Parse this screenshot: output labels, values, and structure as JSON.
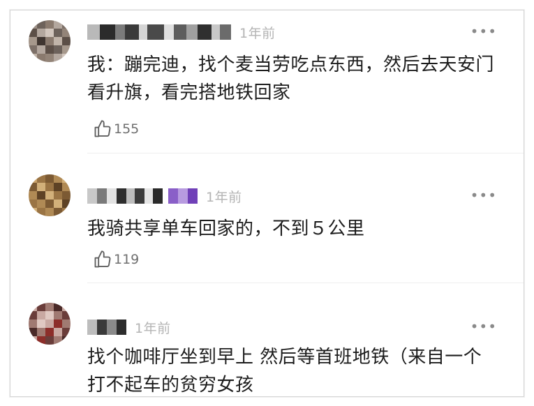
{
  "comments": [
    {
      "time": "1年前",
      "more": "•••",
      "text": "我：蹦完迪，找个麦当劳吃点东西，然后去天安门看升旗，看完搭地铁回家",
      "likes": "155",
      "avatar_colors": [
        "#8a7a6e",
        "#5c4f47",
        "#b3a79e",
        "#6d625b"
      ]
    },
    {
      "time": "1年前",
      "more": "•••",
      "text": "我骑共享单车回家的，不到５公里",
      "likes": "119",
      "avatar_colors": [
        "#b08a55",
        "#7c5a33",
        "#d2b07a",
        "#9a7444"
      ]
    },
    {
      "time": "1年前",
      "more": "•••",
      "text": "找个咖啡厅坐到早上 然后等首班地铁（来自一个打不起车的贫穷女孩",
      "likes": "",
      "avatar_colors": [
        "#a07a72",
        "#6a3d3a",
        "#c9a9a2",
        "#8c2e2a"
      ]
    }
  ],
  "icons": {
    "like": "thumbs-up-outline-icon",
    "more": "more-horizontal-icon"
  }
}
